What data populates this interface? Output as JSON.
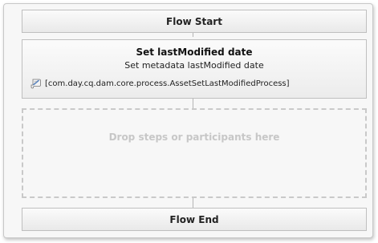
{
  "flow": {
    "start_label": "Flow Start",
    "end_label": "Flow End",
    "step": {
      "title": "Set lastModified date",
      "description": "Set metadata lastModified date",
      "implementation": "[com.day.cq.dam.core.process.AssetSetLastModifiedProcess]",
      "icon": "script-icon"
    },
    "dropzone_label": "Drop steps or participants here"
  }
}
